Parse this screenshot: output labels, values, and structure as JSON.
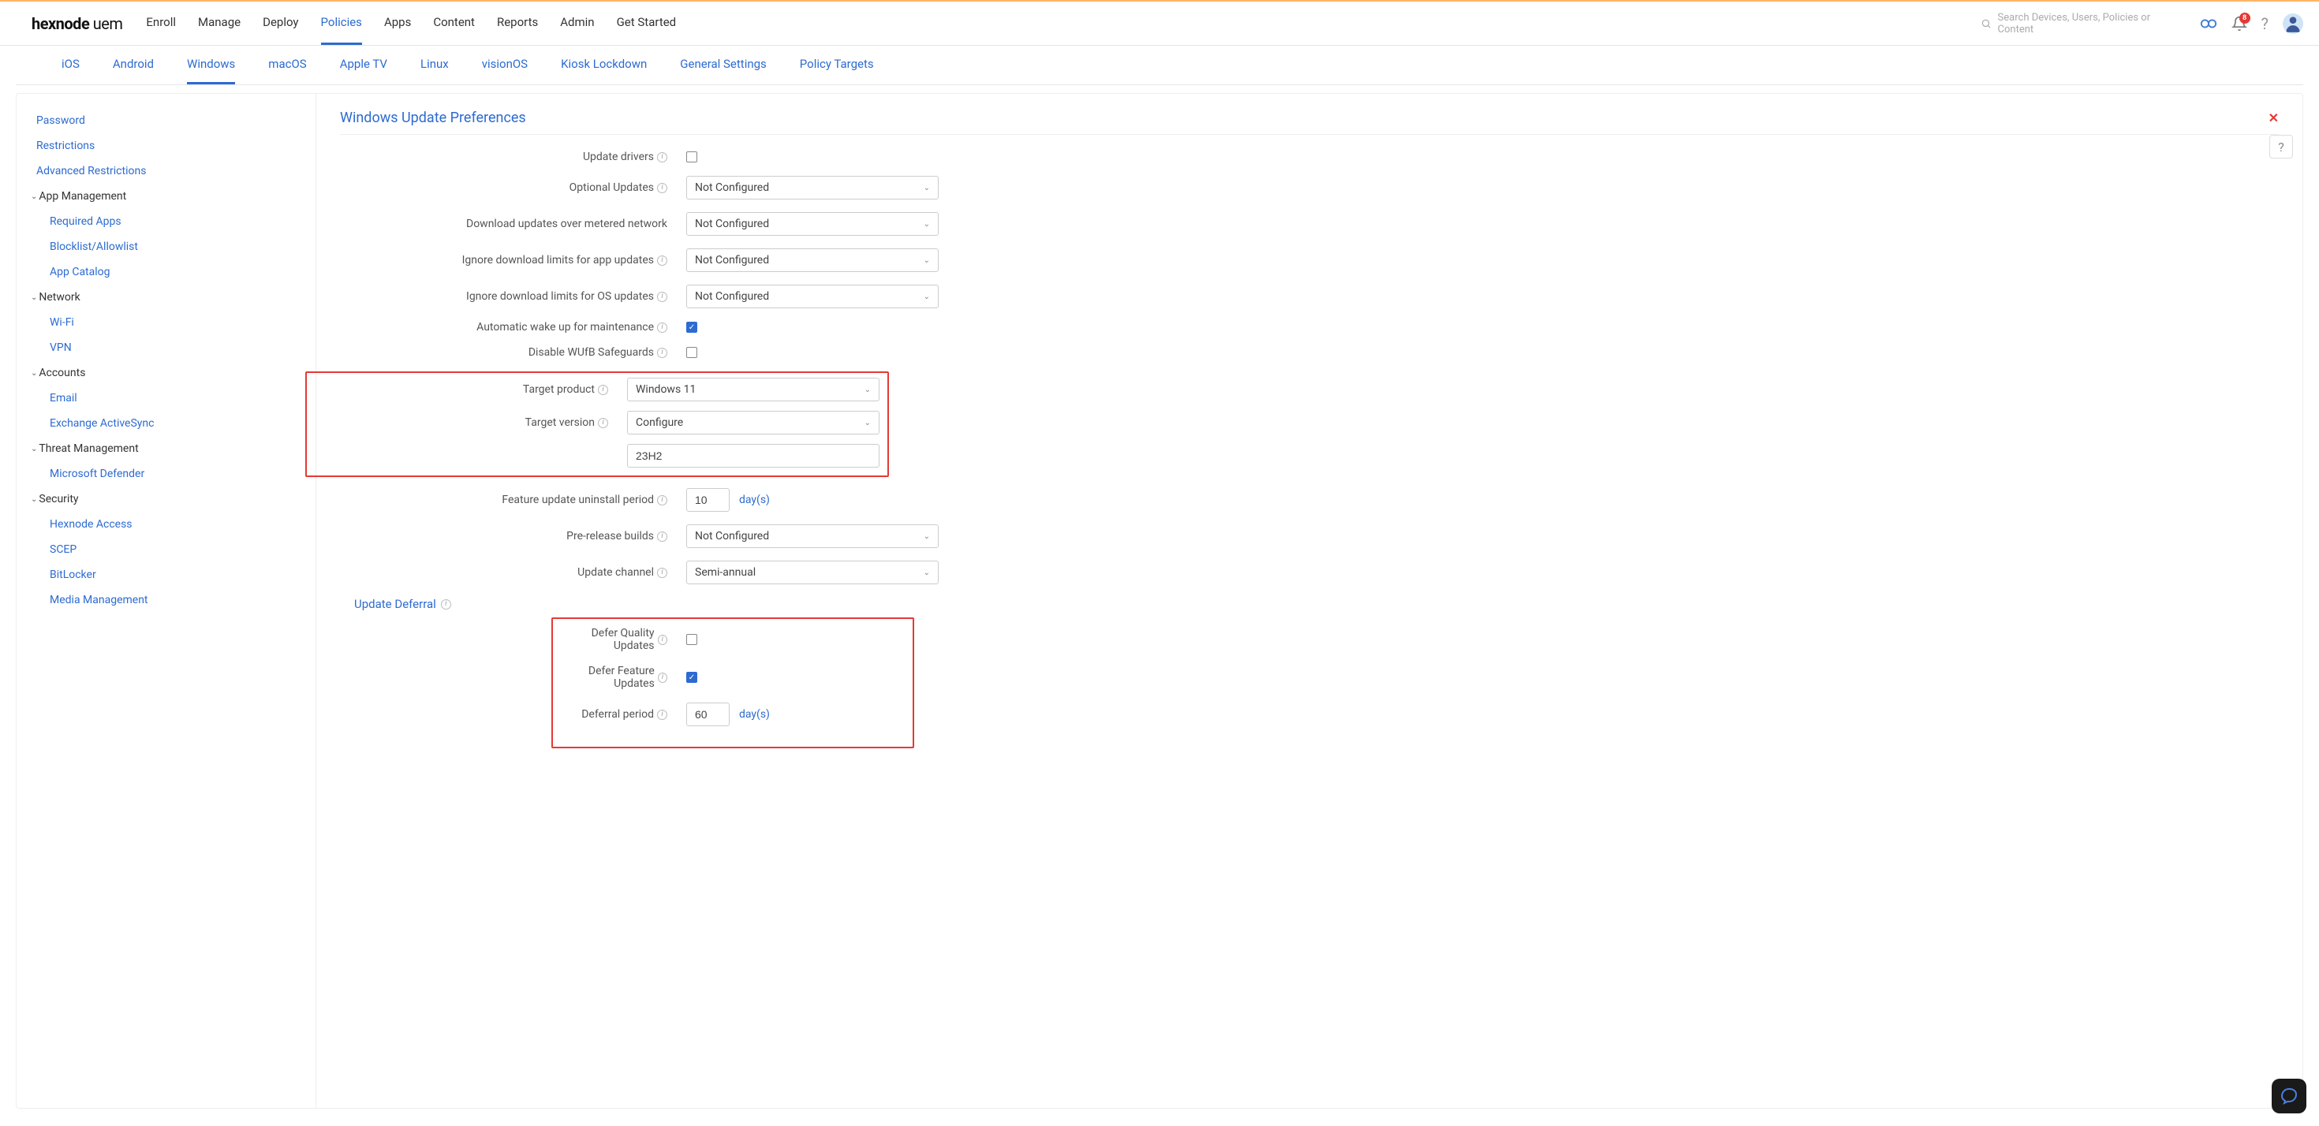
{
  "logo": {
    "brand": "hexnode",
    "suffix": "uem"
  },
  "topnav": {
    "items": [
      "Enroll",
      "Manage",
      "Deploy",
      "Policies",
      "Apps",
      "Content",
      "Reports",
      "Admin",
      "Get Started"
    ],
    "active": 3
  },
  "search": {
    "placeholder": "Search Devices, Users, Policies or Content"
  },
  "notifications": {
    "count": "8"
  },
  "subtabs": {
    "items": [
      "iOS",
      "Android",
      "Windows",
      "macOS",
      "Apple TV",
      "Linux",
      "visionOS",
      "Kiosk Lockdown",
      "General Settings",
      "Policy Targets"
    ],
    "active": 2
  },
  "sidebar": {
    "plain": [
      "Password",
      "Restrictions",
      "Advanced Restrictions"
    ],
    "groups": [
      {
        "label": "App Management",
        "items": [
          "Required Apps",
          "Blocklist/Allowlist",
          "App Catalog"
        ]
      },
      {
        "label": "Network",
        "items": [
          "Wi-Fi",
          "VPN"
        ]
      },
      {
        "label": "Accounts",
        "items": [
          "Email",
          "Exchange ActiveSync"
        ]
      },
      {
        "label": "Threat Management",
        "items": [
          "Microsoft Defender"
        ]
      },
      {
        "label": "Security",
        "items": [
          "Hexnode Access",
          "SCEP",
          "BitLocker",
          "Media Management"
        ]
      }
    ]
  },
  "content": {
    "title": "Windows Update Preferences",
    "rows": {
      "update_drivers": {
        "label": "Update drivers",
        "checked": false
      },
      "optional_updates": {
        "label": "Optional Updates",
        "value": "Not Configured"
      },
      "download_metered": {
        "label": "Download updates over metered network",
        "value": "Not Configured"
      },
      "ignore_app": {
        "label": "Ignore download limits for app updates",
        "value": "Not Configured"
      },
      "ignore_os": {
        "label": "Ignore download limits for OS updates",
        "value": "Not Configured"
      },
      "auto_wake": {
        "label": "Automatic wake up for maintenance",
        "checked": true
      },
      "disable_wufb": {
        "label": "Disable WUfB Safeguards",
        "checked": false
      },
      "target_product": {
        "label": "Target product",
        "value": "Windows 11"
      },
      "target_version": {
        "label": "Target version",
        "value": "Configure"
      },
      "target_version_text": {
        "value": "23H2"
      },
      "uninstall_period": {
        "label": "Feature update uninstall period",
        "value": "10",
        "unit": "day(s)"
      },
      "prerelease": {
        "label": "Pre-release builds",
        "value": "Not Configured"
      },
      "update_channel": {
        "label": "Update channel",
        "value": "Semi-annual"
      }
    },
    "deferral": {
      "heading": "Update Deferral",
      "defer_quality": {
        "label": "Defer Quality Updates",
        "checked": false
      },
      "defer_feature": {
        "label": "Defer Feature Updates",
        "checked": true
      },
      "deferral_period": {
        "label": "Deferral period",
        "value": "60",
        "unit": "day(s)"
      }
    }
  }
}
